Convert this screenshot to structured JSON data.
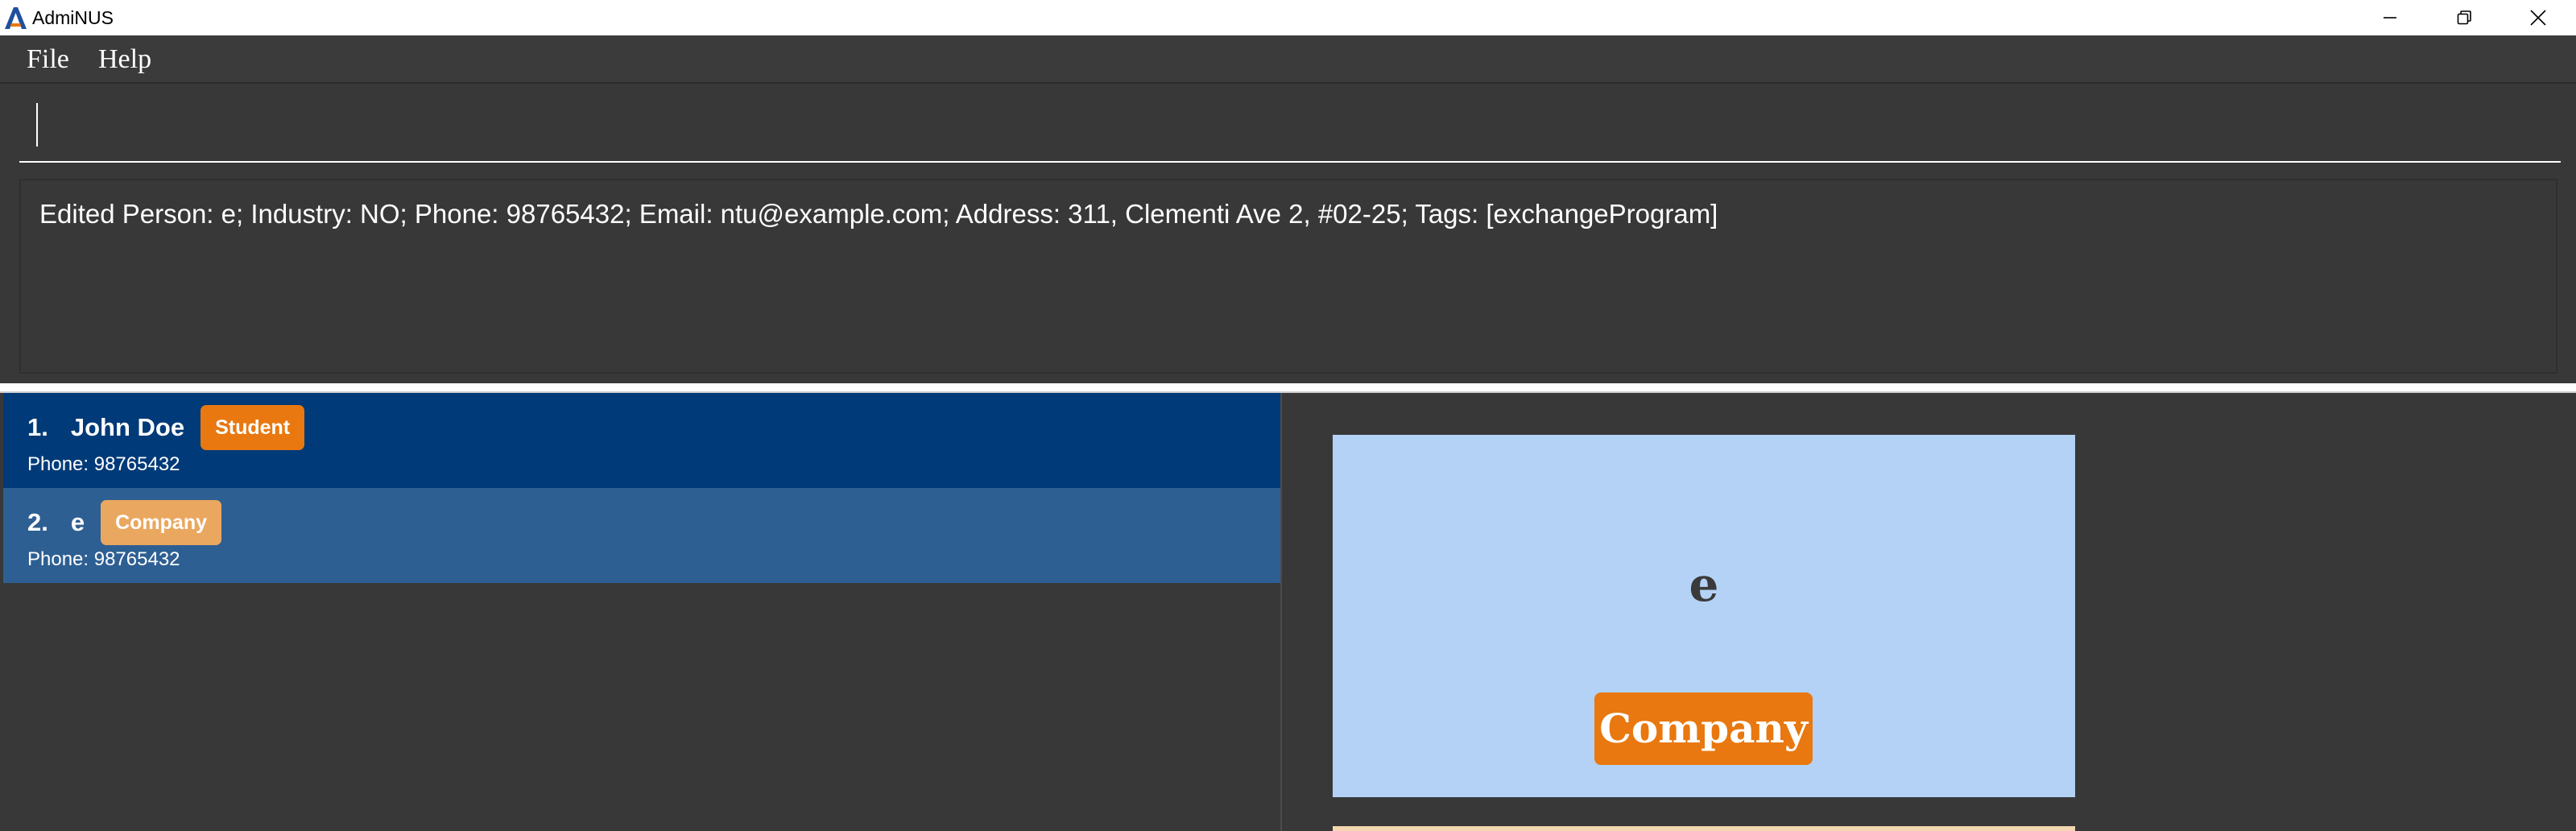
{
  "window": {
    "title": "AdmiNUS",
    "logo_letter": "A",
    "controls": [
      "minimize-icon",
      "restore-icon",
      "close-icon"
    ]
  },
  "menu": {
    "items": [
      {
        "label": "File"
      },
      {
        "label": "Help"
      }
    ]
  },
  "command": {
    "value": "",
    "placeholder": ""
  },
  "result": {
    "text": "Edited Person: e; Industry: NO; Phone: 98765432; Email: ntu@example.com; Address: 311, Clementi Ave 2, #02-25; Tags: [exchangeProgram]"
  },
  "person_list": {
    "items": [
      {
        "index": "1.",
        "name": "John Doe",
        "tag": "Student",
        "phone": "Phone: 98765432",
        "selected": true
      },
      {
        "index": "2.",
        "name": "e",
        "tag": "Company",
        "phone": "Phone: 98765432",
        "selected": false
      }
    ]
  },
  "detail": {
    "name": "e",
    "tag": "Company"
  },
  "colors": {
    "background": "#383838",
    "selected_card": "#003a78",
    "card": "#2e5f93",
    "tag_student": "#e8780f",
    "tag_company": "#eaa75f",
    "detail_card": "#b4d2f5",
    "detail_tag": "#e8780f",
    "logo_blue": "#1f4f9e"
  }
}
